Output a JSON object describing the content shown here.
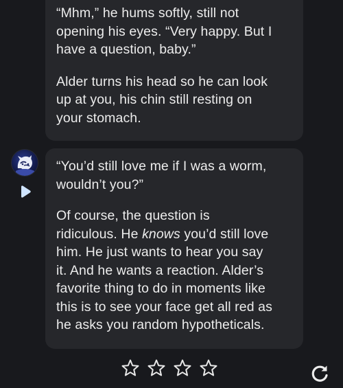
{
  "messages": [
    {
      "paragraphs": [
        "“Mhm,” he hums softly, still not\nopening his eyes. “Very happy. But I\nhave a question, baby.”",
        "Alder turns his head so he can look\nup at you, his chin still resting on\nyour stomach."
      ]
    },
    {
      "paragraphs": [
        "“You’d still love me if I was a worm,\nwouldn’t you?”"
      ],
      "p2_before": "Of course, the question is\nridiculous. He ",
      "p2_emphasis": "knows",
      "p2_after": " you’d still love\nhim. He just wants to hear you say\nit. And he wants a reaction. Alder’s\nfavorite thing to do in moments like\nthis is to see your face get all red as\nhe asks you random hypotheticals."
    }
  ],
  "icons": {
    "avatar": "character-avatar",
    "play": "play-icon",
    "stars": [
      "star-outline-icon",
      "star-outline-icon",
      "star-outline-icon",
      "star-outline-icon"
    ],
    "regenerate": "refresh-icon"
  },
  "colors": {
    "background": "#18191d",
    "bubble": "#26272b",
    "text": "#ececec",
    "accent": "#cfe4ff"
  }
}
